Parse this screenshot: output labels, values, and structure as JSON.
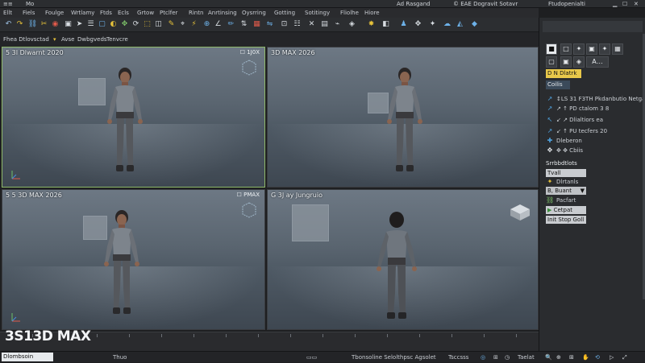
{
  "titlebar": {
    "app_icon_label": "≡≡",
    "left_text": "Mo",
    "center_text": "Ad Rasgand",
    "center_text2": "© EAE Dogravit Sotavr",
    "right_text": "Ftudopenialti"
  },
  "menu": {
    "items": [
      "Ellt",
      "Fiels",
      "Foulge",
      "Wrtlamy",
      "Ftds",
      "Ecls",
      "Grtow",
      "Ptclfer",
      "Rintn",
      "Anrtinsing",
      "Oysrring",
      "Gotting",
      "Sotitingy",
      "Fliolhe",
      "Hiore"
    ]
  },
  "ribbon": {
    "left": "Fhea Dtlovsctad",
    "mid1": "Avse",
    "mid2": "Dwbgveds",
    "mid3": "Tenvcre"
  },
  "viewports": [
    {
      "label": "5 3I Dlwarnt 2020",
      "tag": "☐ 1J0X",
      "active": true
    },
    {
      "label": "3D MAX 2026",
      "tag": "",
      "active": false
    },
    {
      "label": "5 5 3D MAX 2026",
      "tag": "☐ PMAX",
      "active": false
    },
    {
      "label": "G 3J ay Jungruio",
      "tag": "",
      "active": false
    }
  ],
  "command_panel": {
    "tabs": [
      "■",
      "□",
      "✦",
      "▣",
      "✦",
      "▦"
    ],
    "tab_row2": [
      "▢",
      "▣",
      "◈",
      "A…"
    ],
    "active_rollout": "D N Dlatrk",
    "section_title": "Coilis",
    "rows": [
      {
        "icon": "pen-icon",
        "glyph": "↗",
        "text": "↕LS 31 F3TH  Pkdanbutio Netgard"
      },
      {
        "icon": "wand-icon",
        "glyph": "↗",
        "text": "↗  ↑  PD ctalom 3 8"
      },
      {
        "icon": "arrow-icon",
        "glyph": "↖",
        "text": "↙ ↗  Dlialtiors ea"
      },
      {
        "icon": "cursor-icon",
        "glyph": "↗",
        "text": "↙  ↑  PU tecfers 20"
      },
      {
        "icon": "cross-icon",
        "glyph": "✚",
        "text": "Dleberon"
      },
      {
        "icon": "move-icon",
        "glyph": "✥",
        "text": "✥ ✥  Cbiis"
      }
    ],
    "section2_title": "Srrbbdtlots",
    "buttons": [
      "Tvall",
      "Dlrtanls",
      "Buant",
      "Pacfart",
      "Cetpat",
      "Init Stop Goll"
    ],
    "dropdown_label": "B, Buant",
    "dropdown_value": "▼"
  },
  "timeline": {
    "watermark": "3S13D MAX",
    "left_box": "Dlombsoin"
  },
  "status": {
    "left": "Dlombsoin",
    "mid1": "Thuo",
    "mid2": "Tbonsoline Selolthpsc Agsolet",
    "mid3": "Tsccsss",
    "right": "Taelat"
  },
  "colors": {
    "active_viewport": "#8fb96b",
    "accent_blue": "#4fa3e0",
    "accent_yellow": "#e6c23a",
    "rollout_yellow": "#e8c84a"
  }
}
